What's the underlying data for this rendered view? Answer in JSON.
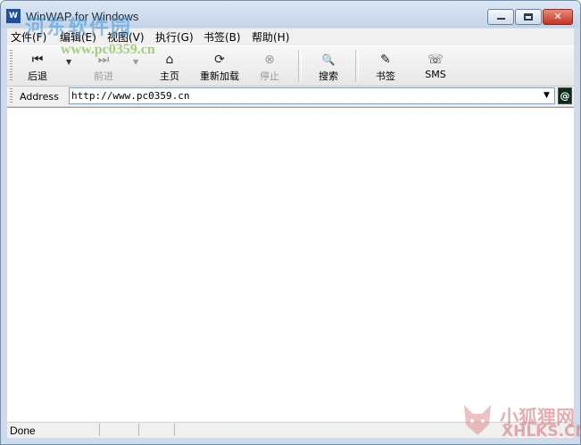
{
  "window": {
    "title": "WinWAP for Windows",
    "icon": "winwap-app-icon"
  },
  "window_controls": {
    "minimize": "minimize-icon",
    "maximize": "maximize-icon",
    "close": "close-icon",
    "close_glyph": "✕"
  },
  "menu": [
    {
      "label": "文件(F)"
    },
    {
      "label": "编辑(E)"
    },
    {
      "label": "视图(V)"
    },
    {
      "label": "执行(G)"
    },
    {
      "label": "书签(B)"
    },
    {
      "label": "帮助(H)"
    }
  ],
  "toolbar": {
    "back": {
      "label": "后退",
      "icon": "back-icon",
      "glyph": "⏮"
    },
    "forward": {
      "label": "前进",
      "icon": "forward-icon",
      "glyph": "⏭",
      "enabled": false
    },
    "home": {
      "label": "主页",
      "icon": "home-icon",
      "glyph": "⌂"
    },
    "reload": {
      "label": "重新加载",
      "icon": "reload-icon",
      "glyph": "⟳"
    },
    "stop": {
      "label": "停止",
      "icon": "stop-icon",
      "glyph": "⊗",
      "enabled": false
    },
    "search": {
      "label": "搜索",
      "icon": "search-icon",
      "glyph": "🔍"
    },
    "bookmarks": {
      "label": "书签",
      "icon": "bookmark-icon",
      "glyph": "✎"
    },
    "sms": {
      "label": "SMS",
      "icon": "sms-phone-icon",
      "glyph": "☏"
    },
    "dropdown_glyph": "▼"
  },
  "address": {
    "label": "Address",
    "value": "http://www.pc0359.cn",
    "dropdown_glyph": "▼",
    "go_glyph": "@"
  },
  "status": {
    "text": "Done"
  },
  "watermarks": {
    "top_left": "河东软件园",
    "top_url": "www.pc0359.cn",
    "bottom_right_cn": "小狐狸网",
    "bottom_right_en": "XHLKS.CN"
  },
  "colors": {
    "titlebar": "#c3d3e8",
    "close_button": "#c2341f",
    "content_bg": "#ffffff"
  }
}
